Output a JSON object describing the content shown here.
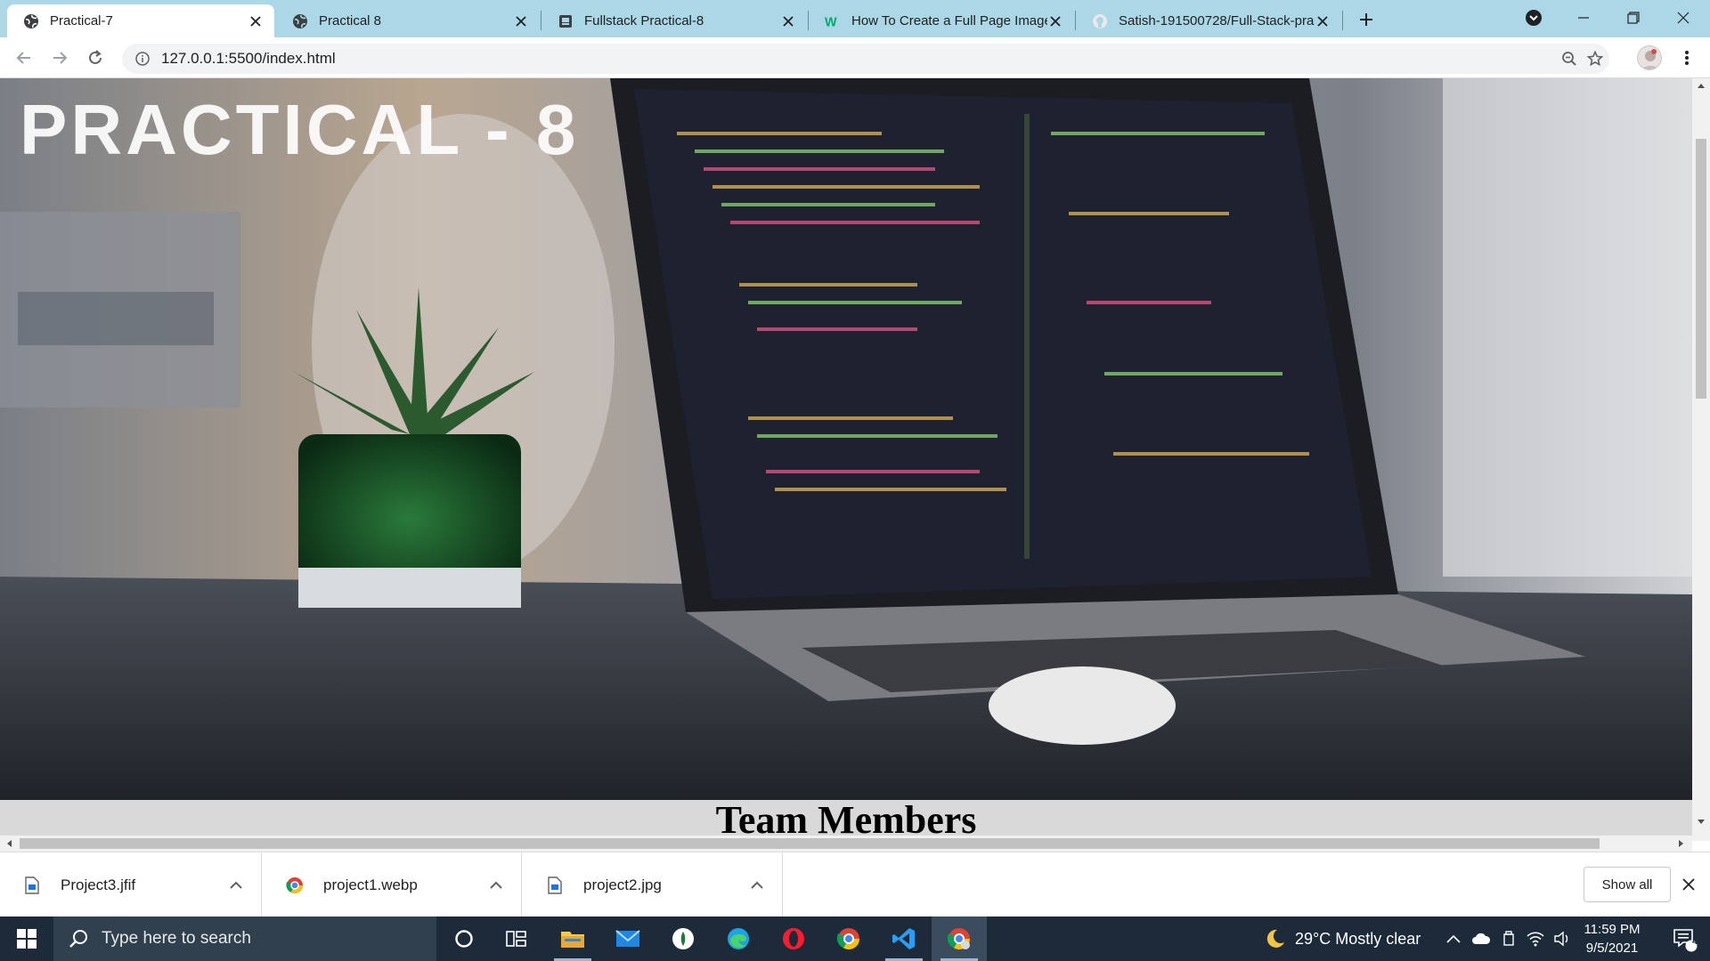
{
  "browser": {
    "tabs": [
      {
        "title": "Practical-7",
        "active": true,
        "favicon": "globe-icon"
      },
      {
        "title": "Practical 8",
        "active": false,
        "favicon": "globe-icon"
      },
      {
        "title": "Fullstack Practical-8",
        "active": false,
        "favicon": "document-icon"
      },
      {
        "title": "How To Create a Full Page Image",
        "active": false,
        "favicon": "w3schools-icon"
      },
      {
        "title": "Satish-191500728/Full-Stack-pra",
        "active": false,
        "favicon": "github-icon"
      }
    ],
    "url": "127.0.0.1:5500/index.html"
  },
  "page": {
    "hero_title": "PRACTICAL - 8",
    "section_title": "Team Members"
  },
  "downloads": {
    "items": [
      {
        "name": "Project3.jfif",
        "icon": "file-icon"
      },
      {
        "name": "project1.webp",
        "icon": "chrome-icon"
      },
      {
        "name": "project2.jpg",
        "icon": "file-icon"
      }
    ],
    "show_all_label": "Show all"
  },
  "taskbar": {
    "search_placeholder": "Type here to search",
    "weather": "29°C  Mostly clear",
    "time": "11:59 PM",
    "date": "9/5/2021",
    "notification_count": "4"
  },
  "colors": {
    "tabstrip": "#abd7e6",
    "taskbar": "#1c2a3a",
    "section_band": "#d9d9d9"
  }
}
